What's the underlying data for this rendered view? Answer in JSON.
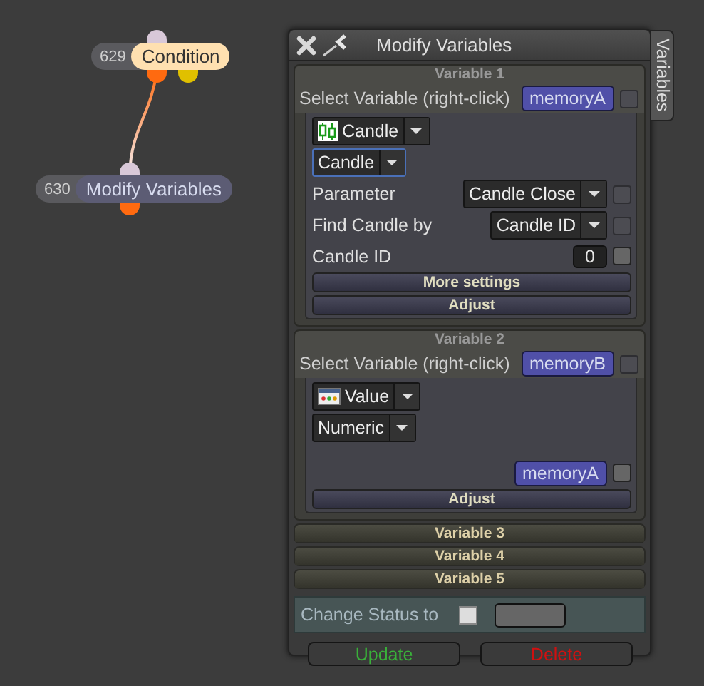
{
  "nodes": [
    {
      "id": "629",
      "label": "Condition",
      "selected": true
    },
    {
      "id": "630",
      "label": "Modify Variables",
      "selected": false
    }
  ],
  "panel": {
    "title": "Modify Variables",
    "side_tab": "Variables",
    "variables": [
      {
        "header": "Variable 1",
        "expanded": true,
        "select_label": "Select Variable (right-click)",
        "variable": "memoryA",
        "variable_check": {
          "checked": false,
          "disabled": true
        },
        "type": {
          "kind": "candle",
          "label": "Candle"
        },
        "subtype": {
          "label": "Candle",
          "focused": true
        },
        "rows": [
          {
            "kind": "dropdown",
            "label": "Parameter",
            "value": "Candle Close",
            "checked": false,
            "disabled": true
          },
          {
            "kind": "dropdown",
            "label": "Find Candle by",
            "value": "Candle ID",
            "checked": false,
            "disabled": true
          },
          {
            "kind": "number",
            "label": "Candle ID",
            "value": "0",
            "checked": false
          }
        ],
        "buttons": [
          "More settings",
          "Adjust"
        ]
      },
      {
        "header": "Variable 2",
        "expanded": true,
        "select_label": "Select Variable (right-click)",
        "variable": "memoryB",
        "variable_check": {
          "checked": false,
          "disabled": true
        },
        "type": {
          "kind": "value",
          "label": "Value"
        },
        "subtype": {
          "label": "Numeric",
          "focused": false
        },
        "rows": [
          {
            "kind": "variable",
            "value": "memoryA",
            "checked": false
          }
        ],
        "buttons": [
          "Adjust"
        ]
      },
      {
        "header": "Variable 3",
        "expanded": false
      },
      {
        "header": "Variable 4",
        "expanded": false
      },
      {
        "header": "Variable 5",
        "expanded": false
      }
    ],
    "status": {
      "label": "Change Status to",
      "checked": false
    },
    "actions": [
      {
        "label": "Update",
        "kind": "confirm"
      },
      {
        "label": "Delete",
        "kind": "danger"
      }
    ]
  }
}
